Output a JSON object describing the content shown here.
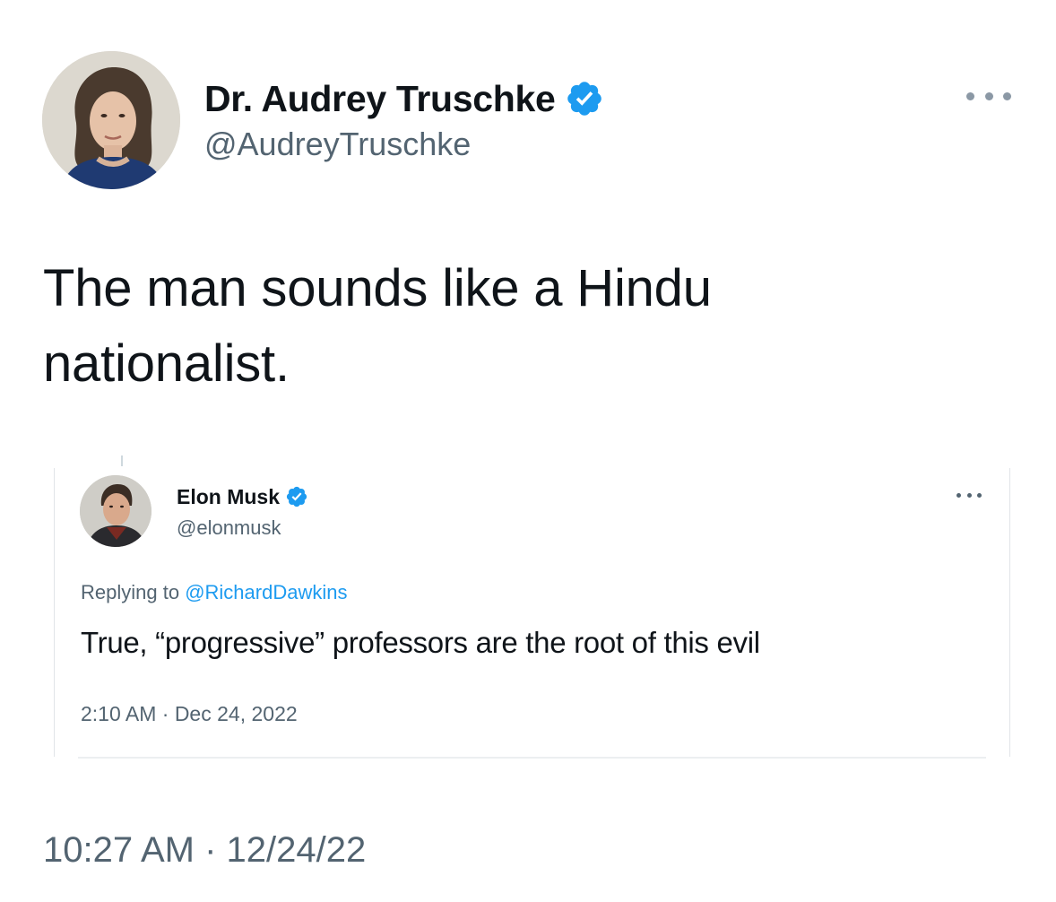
{
  "tweet": {
    "author": {
      "name": "Dr. Audrey Truschke",
      "handle": "@AudreyTruschke",
      "verified": true,
      "avatar_icon": "profile-photo-woman"
    },
    "text": "The man sounds like a Hindu nationalist.",
    "timestamp": "10:27 AM · 12/24/22"
  },
  "quoted_tweet": {
    "author": {
      "name": "Elon Musk",
      "handle": "@elonmusk",
      "verified": true,
      "avatar_icon": "profile-photo-man"
    },
    "replying_label": "Replying to",
    "replying_to": "@RichardDawkins",
    "text": "True, “progressive” professors are the root of this evil",
    "timestamp": "2:10 AM · Dec 24, 2022"
  },
  "icons": {
    "more": "more-horizontal-icon",
    "verified": "verified-badge-icon"
  },
  "colors": {
    "accent": "#1d9bf0",
    "text": "#0f1419",
    "secondary": "#536471"
  }
}
